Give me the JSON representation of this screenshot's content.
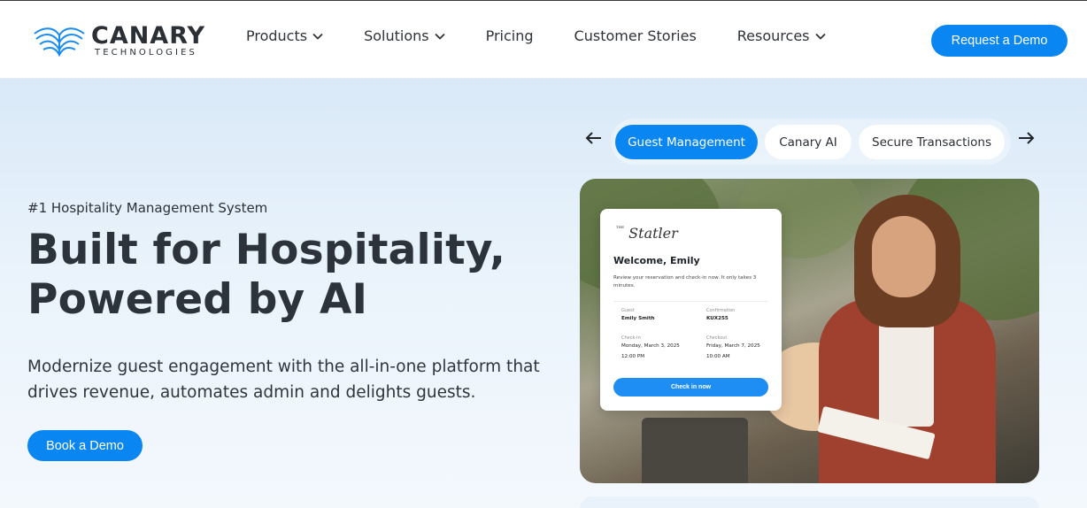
{
  "header": {
    "logo": {
      "name": "CANARY",
      "sub": "TECHNOLOGIES",
      "icon": "canary-wings-logo-icon",
      "color": "#1a8cf0"
    },
    "nav": [
      {
        "label": "Products",
        "has_dropdown": true
      },
      {
        "label": "Solutions",
        "has_dropdown": true
      },
      {
        "label": "Pricing",
        "has_dropdown": false
      },
      {
        "label": "Customer Stories",
        "has_dropdown": false
      },
      {
        "label": "Resources",
        "has_dropdown": true
      }
    ],
    "cta": "Request a Demo"
  },
  "hero": {
    "eyebrow": "#1 Hospitality Management System",
    "headline_line1": "Built for Hospitality,",
    "headline_line2": "Powered by AI",
    "subtext": "Modernize guest engagement with the all-in-one platform that drives revenue, automates admin and delights guests.",
    "cta": "Book a Demo"
  },
  "tabs": {
    "prev_icon": "arrow-left-icon",
    "next_icon": "arrow-right-icon",
    "items": [
      {
        "label": "Guest Management",
        "active": true
      },
      {
        "label": "Canary AI",
        "active": false
      },
      {
        "label": "Secure Transactions",
        "active": false
      }
    ]
  },
  "checkin_card": {
    "brand": "Statler",
    "brand_prefix": "THE",
    "welcome": "Welcome, Emily",
    "description": "Review your reservation and check-in now. It only takes 3 minutes.",
    "guest_label": "Guest",
    "guest_value": "Emily Smith",
    "confirmation_label": "Confirmation",
    "confirmation_value": "KUX255",
    "checkin_label": "Check-in",
    "checkin_date": "Monday, March 3, 2025",
    "checkin_time": "12:00 PM",
    "checkout_label": "Checkout",
    "checkout_date": "Friday, March 7, 2025",
    "checkout_time": "10:00 AM",
    "button": "Check in now"
  },
  "colors": {
    "accent": "#0a86f2",
    "text": "#2d333a"
  }
}
